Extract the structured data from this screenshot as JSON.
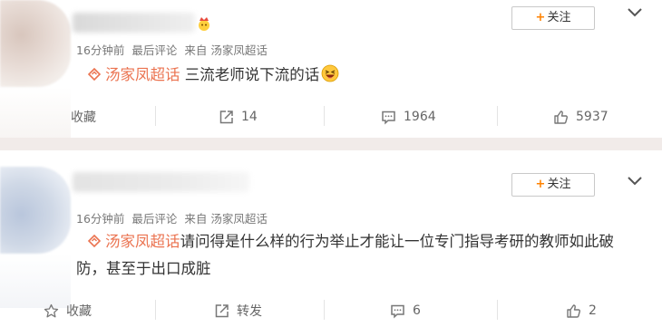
{
  "post1": {
    "follow_label": "关注",
    "meta": {
      "time": "16分钟前",
      "type": "最后评论",
      "source": "来自 汤家凤超话"
    },
    "topic": "汤家凤超话",
    "text": "三流老师说下流的话",
    "actions": {
      "favorite": "收藏",
      "repost": "14",
      "comment": "1964",
      "like": "5937"
    }
  },
  "post2": {
    "follow_label": "关注",
    "meta": {
      "time": "16分钟前",
      "type": "最后评论",
      "source": "来自 汤家凤超话"
    },
    "topic": "汤家凤超话",
    "text": "请问得是什么样的行为举止才能让一位专门指导考研的教师如此破防，甚至于出口成脏",
    "actions": {
      "favorite": "收藏",
      "repost": "转发",
      "comment": "6",
      "like": "2"
    }
  },
  "colors": {
    "accent": "#ff8200",
    "topic": "#eb7350",
    "divider": "#f1ebe9"
  },
  "icons": [
    "crown-emoji-icon",
    "chevron-down-icon",
    "topic-diamond-icon",
    "laughing-emoji-icon",
    "repost-icon",
    "comment-icon",
    "like-icon"
  ]
}
